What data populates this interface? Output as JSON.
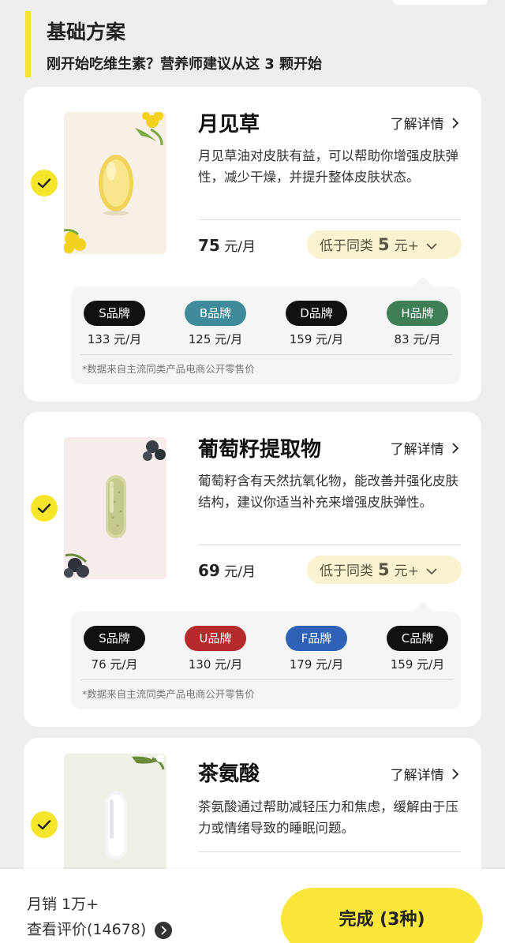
{
  "section": {
    "title": "基础方案",
    "subtitle": "刚开始吃维生素？营养师建议从这 3 颗开始",
    "accent_color": "#f5e52b"
  },
  "products": [
    {
      "name": "月见草",
      "details_label": "了解详情",
      "description": "月见草油对皮肤有益，可以帮助你增强皮肤弹性，减少干燥，并提升整体皮肤状态。",
      "price_value": "75",
      "price_unit": "元/月",
      "lower_label": "低于同类",
      "lower_amount": "5",
      "lower_unit": "元+",
      "selected": true,
      "icon": "softgel-capsule",
      "brands": [
        {
          "name": "S品牌",
          "price": "133 元/月",
          "color": "#111111"
        },
        {
          "name": "B品牌",
          "price": "125 元/月",
          "color": "#3f8a9b"
        },
        {
          "name": "D品牌",
          "price": "159 元/月",
          "color": "#111111"
        },
        {
          "name": "H品牌",
          "price": "83 元/月",
          "color": "#3e7f55"
        }
      ],
      "note": "*数据来自主流同类产品电商公开零售价"
    },
    {
      "name": "葡萄籽提取物",
      "details_label": "了解详情",
      "description": "葡萄籽含有天然抗氧化物，能改善并强化皮肤结构，建议你适当补充来增强皮肤弹性。",
      "price_value": "69",
      "price_unit": "元/月",
      "lower_label": "低于同类",
      "lower_amount": "5",
      "lower_unit": "元+",
      "selected": true,
      "icon": "capsule",
      "brands": [
        {
          "name": "S品牌",
          "price": "76 元/月",
          "color": "#111111"
        },
        {
          "name": "U品牌",
          "price": "130 元/月",
          "color": "#b52a2a"
        },
        {
          "name": "F品牌",
          "price": "179 元/月",
          "color": "#2f62b6"
        },
        {
          "name": "C品牌",
          "price": "159 元/月",
          "color": "#111111"
        }
      ],
      "note": "*数据来自主流同类产品电商公开零售价"
    },
    {
      "name": "茶氨酸",
      "details_label": "了解详情",
      "description": "茶氨酸通过帮助减轻压力和焦虑，缓解由于压力或情绪导致的睡眠问题。",
      "selected": true,
      "icon": "white-capsule"
    }
  ],
  "footer": {
    "sales": "月销 1万+",
    "reviews": "查看评价(14678)",
    "done_button": "完成 (3种)",
    "button_color": "#fae53b"
  }
}
